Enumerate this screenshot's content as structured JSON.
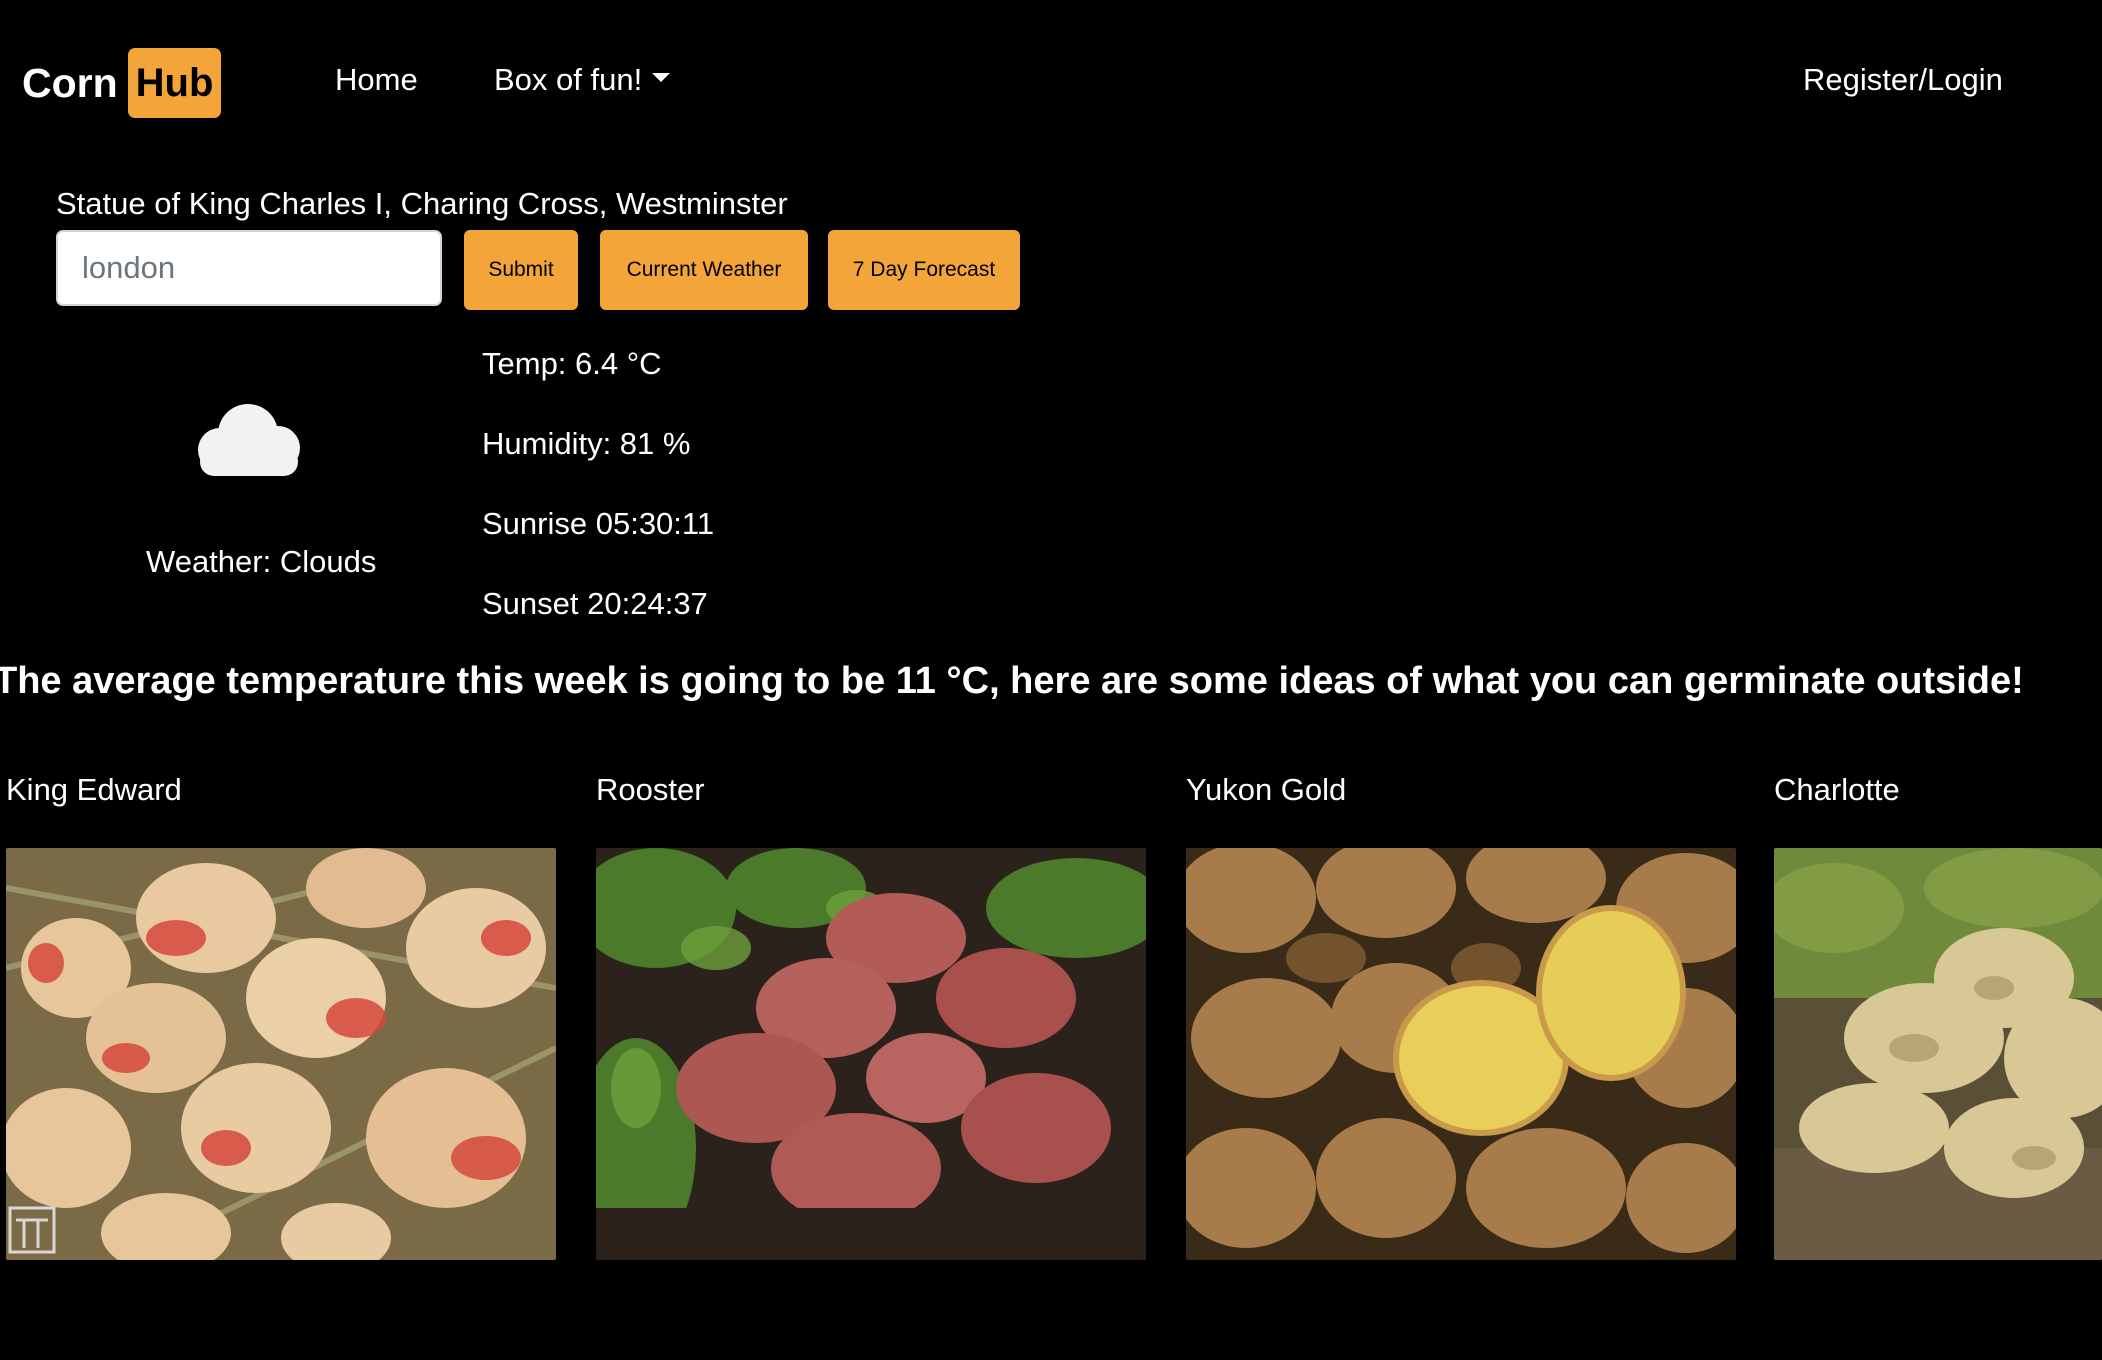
{
  "brand": {
    "part1": "Corn",
    "part2": "Hub"
  },
  "nav": {
    "home": "Home",
    "dropdown": "Box of fun!",
    "register": "Register/Login"
  },
  "location": "Statue of King Charles I, Charing Cross, Westminster",
  "search": {
    "value": "london"
  },
  "buttons": {
    "submit": "Submit",
    "current": "Current Weather",
    "forecast": "7 Day Forecast"
  },
  "weather": {
    "icon": "cloud-icon",
    "label": "Weather: Clouds",
    "temp": "Temp: 6.4 °C",
    "humidity": "Humidity: 81 %",
    "sunrise": "Sunrise 05:30:11",
    "sunset": "Sunset 20:24:37"
  },
  "average_message": "The average temperature this week is going to be 11 °C, here are some ideas of what you can germinate outside!",
  "potatoes": [
    {
      "name": "King Edward"
    },
    {
      "name": "Rooster"
    },
    {
      "name": "Yukon Gold"
    },
    {
      "name": "Charlotte"
    }
  ],
  "colors": {
    "accent": "#f3a53a",
    "background": "#000000",
    "text": "#ffffff"
  }
}
